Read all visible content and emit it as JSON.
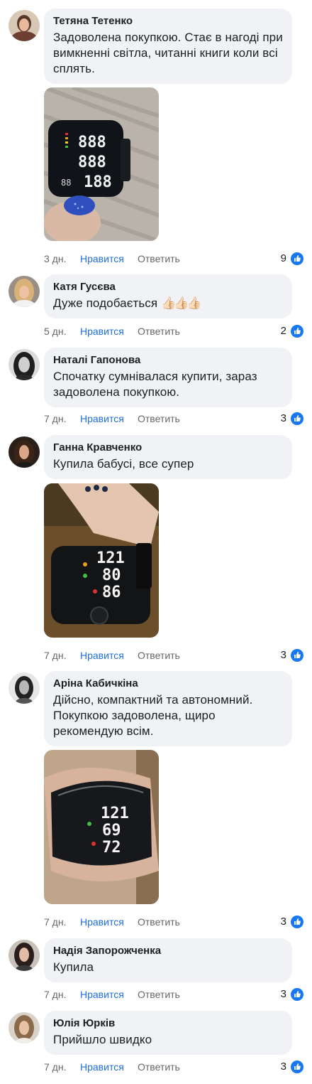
{
  "actions": {
    "like": "Нравится",
    "reply": "Ответить"
  },
  "colors": {
    "bubble": "#f0f2f5",
    "like_link": "#216fdb",
    "meta_text": "#65676b",
    "like_badge": "#1877f2"
  },
  "icons": {
    "reaction": "thumbs-up-icon"
  },
  "comments": [
    {
      "author": "Тетяна Тетенко",
      "text": "Задоволена покупкою. Стає в нагоді при вимкненні світла, читанні книги коли всі сплять.",
      "time": "3 дн.",
      "likes": "9",
      "photo": "tonometer-readings-888"
    },
    {
      "author": "Катя Гусєва",
      "text": "Дуже подобається",
      "emoji": "👍🏻👍🏻👍🏻",
      "time": "5 дн.",
      "likes": "2"
    },
    {
      "author": "Наталі Гапонова",
      "text": "Спочатку сумнівалася купити, зараз задоволена покупкою.",
      "time": "7 дн.",
      "likes": "3"
    },
    {
      "author": "Ганна Кравченко",
      "text": "Купила бабусі, все супер",
      "time": "7 дн.",
      "likes": "3",
      "photo": "tonometer-on-wrist-121-80-86"
    },
    {
      "author": "Аріна Кабичкіна",
      "text": "Дійсно, компактний та автономний. Покупкою задоволена, щиро рекомендую всім.",
      "time": "7 дн.",
      "likes": "3",
      "photo": "tonometer-on-wrist-121-69-72"
    },
    {
      "author": "Надія Запорожченка",
      "text": "Купила",
      "time": "7 дн.",
      "likes": "3"
    },
    {
      "author": "Юлія Юрків",
      "text": "Прийшло швидко",
      "time": "7 дн.",
      "likes": "3"
    }
  ]
}
